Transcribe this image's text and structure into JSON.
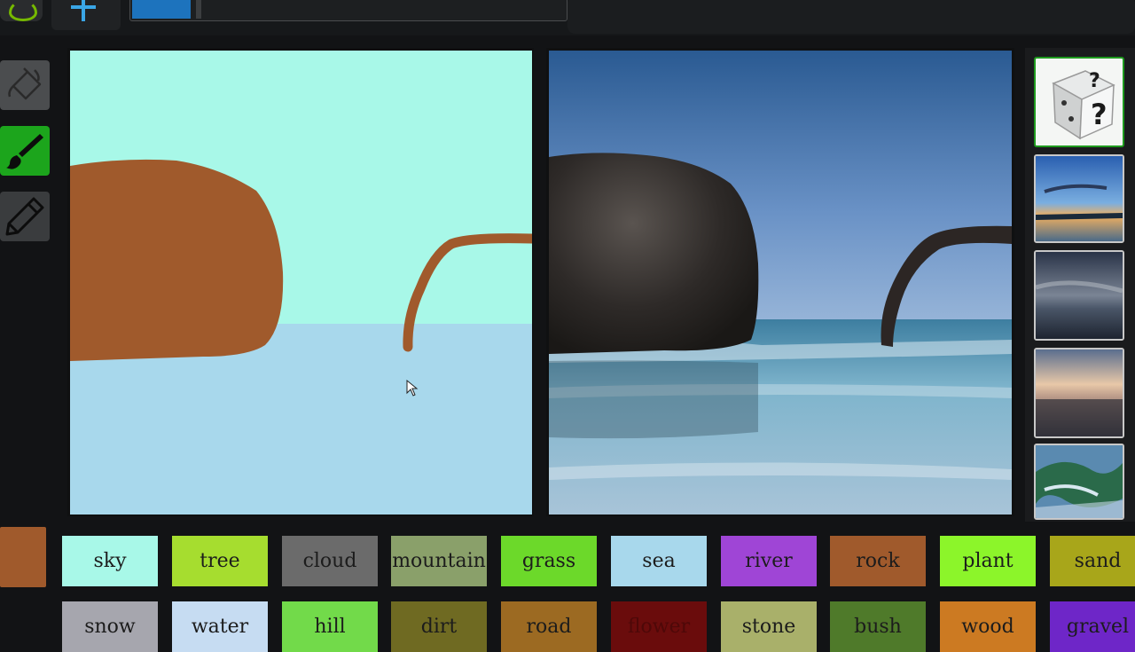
{
  "app": {
    "current_label_color": "#a05a2c"
  },
  "tools": [
    {
      "name": "fill",
      "icon": "paint-bucket-icon"
    },
    {
      "name": "brush",
      "icon": "brush-icon",
      "active": true
    },
    {
      "name": "pencil",
      "icon": "pencil-icon"
    }
  ],
  "colors": {
    "canvas_sky": "#a8f8e8",
    "canvas_sea": "#a8d8ec",
    "canvas_rock": "#a05a2c",
    "active_tool": "#1ca51c"
  },
  "labels_row1": [
    {
      "label": "sky",
      "color": "#a8f8e8"
    },
    {
      "label": "tree",
      "color": "#a6dd2f"
    },
    {
      "label": "cloud",
      "color": "#6b6b6b"
    },
    {
      "label": "mountain",
      "color": "#8aa06a"
    },
    {
      "label": "grass",
      "color": "#6cd92a"
    },
    {
      "label": "sea",
      "color": "#a8d8ec"
    },
    {
      "label": "river",
      "color": "#9f45d6"
    },
    {
      "label": "rock",
      "color": "#a05a2c"
    },
    {
      "label": "plant",
      "color": "#8cf52a"
    },
    {
      "label": "sand",
      "color": "#a8a61a"
    }
  ],
  "labels_row2": [
    {
      "label": "snow",
      "color": "#a6a6ae"
    },
    {
      "label": "water",
      "color": "#c6dcf2"
    },
    {
      "label": "hill",
      "color": "#72da4a"
    },
    {
      "label": "dirt",
      "color": "#6f6a22"
    },
    {
      "label": "road",
      "color": "#9c6a22"
    },
    {
      "label": "flower",
      "color": "#6a0c0c"
    },
    {
      "label": "stone",
      "color": "#a9b06a"
    },
    {
      "label": "bush",
      "color": "#4f7a2a"
    },
    {
      "label": "wood",
      "color": "#cc7a22"
    },
    {
      "label": "gravel",
      "color": "#6e26c8"
    }
  ]
}
